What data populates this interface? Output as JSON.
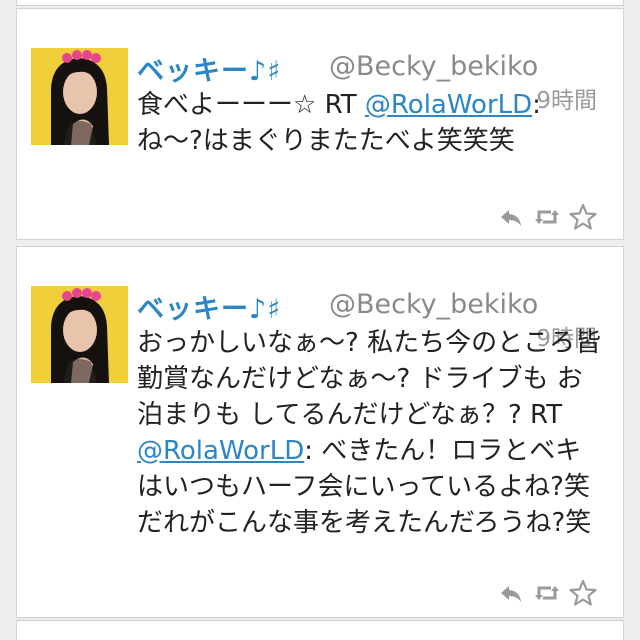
{
  "tweets": [
    {
      "display_name": "ベッキー♪♯",
      "handle": "@Becky_bekiko",
      "time": "9時間",
      "text_before": "食べよーーー☆ RT ",
      "mention": "@RolaWorLD",
      "text_after": ": ね〜?はまぐりまたたべよ笑笑笑",
      "actions": [
        "reply-icon",
        "retweet-icon",
        "favorite-star-icon"
      ]
    },
    {
      "display_name": "ベッキー♪♯",
      "handle": "@Becky_bekiko",
      "time": "9時間",
      "text_before": "おっかしいなぁ〜? 私たち今のところ皆勤賞なんだけどなぁ〜? ドライブも お泊まりも してるんだけどなぁ？? RT ",
      "mention": "@RolaWorLD",
      "text_after": ": べきたん！ロラとベキはいつもハーフ会にいっているよね?笑 だれがこんな事を考えたんだろうね?笑",
      "actions": [
        "reply-icon",
        "retweet-icon",
        "favorite-star-icon"
      ]
    }
  ],
  "colors": {
    "link": "#2a86c4",
    "meta": "#8a8a8a",
    "background": "#ededed",
    "card": "#ffffff"
  }
}
